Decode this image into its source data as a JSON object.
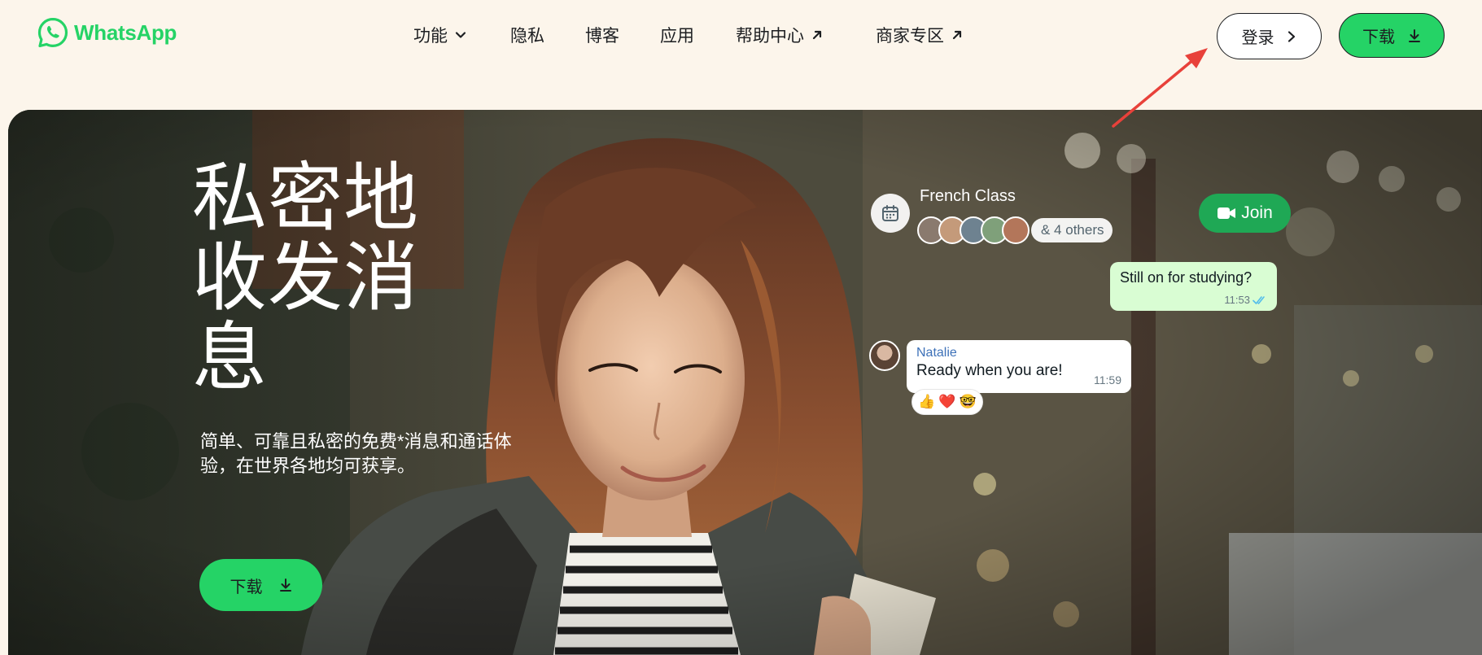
{
  "brand": {
    "name": "WhatsApp",
    "logo_icon": "whatsapp-logo-icon",
    "color": "#25d366"
  },
  "nav": {
    "features": {
      "label": "功能",
      "icon": "chevron-down-icon"
    },
    "privacy": {
      "label": "隐私"
    },
    "blog": {
      "label": "博客"
    },
    "apps": {
      "label": "应用"
    },
    "help_center": {
      "label": "帮助中心",
      "icon": "external-arrow-icon"
    },
    "business": {
      "label": "商家专区",
      "icon": "external-arrow-icon"
    }
  },
  "header_actions": {
    "login": {
      "label": "登录",
      "icon": "chevron-right-icon"
    },
    "download": {
      "label": "下载",
      "icon": "download-icon"
    }
  },
  "annotation": {
    "color": "#e8413a",
    "icon": "red-arrow-pointer"
  },
  "hero": {
    "headline": "私密地收发消息",
    "subtitle": "简单、可靠且私密的免费*消息和通话体验，在世界各地均可获享。",
    "download_label": "下载"
  },
  "chat": {
    "group_name": "French Class",
    "others": "& 4 others",
    "join_label": "Join",
    "outgoing": {
      "text": "Still on for studying?",
      "time": "11:53"
    },
    "incoming": {
      "sender": "Natalie",
      "text": "Ready when you are!",
      "time": "11:59"
    },
    "reactions": [
      "👍",
      "❤️",
      "🤓"
    ]
  }
}
